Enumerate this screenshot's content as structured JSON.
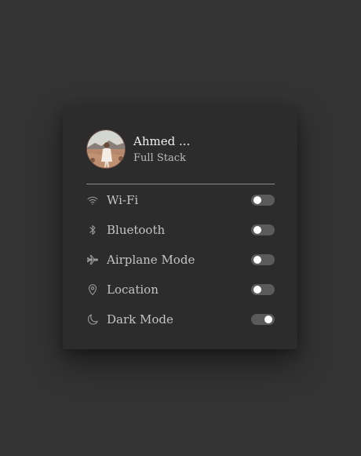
{
  "profile": {
    "name": "Ahmed ...",
    "role": "Full Stack"
  },
  "settings": [
    {
      "label": "Wi-Fi",
      "icon": "wifi-icon",
      "enabled": false
    },
    {
      "label": "Bluetooth",
      "icon": "bluetooth-icon",
      "enabled": false
    },
    {
      "label": "Airplane Mode",
      "icon": "airplane-icon",
      "enabled": false
    },
    {
      "label": "Location",
      "icon": "location-pin-icon",
      "enabled": false
    },
    {
      "label": "Dark Mode",
      "icon": "moon-icon",
      "enabled": true
    }
  ],
  "colors": {
    "background": "#333333",
    "card": "#2c2c2c",
    "toggle_track": "#5b5b5b",
    "toggle_knob": "#ffffff",
    "text_primary": "#f2f2f2",
    "text_secondary": "#c4c4c4"
  }
}
